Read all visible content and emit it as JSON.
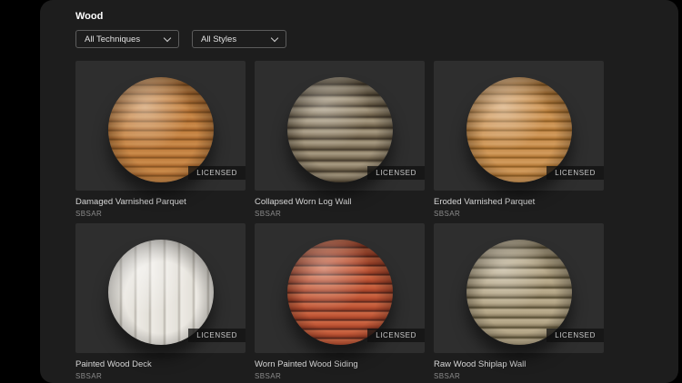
{
  "header": {
    "title": "Wood"
  },
  "filters": {
    "techniques": {
      "label": "All Techniques"
    },
    "styles": {
      "label": "All Styles"
    }
  },
  "badge_label": "LICENSED",
  "cards": [
    {
      "name": "Damaged Varnished Parquet",
      "format": "SBSAR",
      "base_color": "#b5763a"
    },
    {
      "name": "Collapsed Worn Log Wall",
      "format": "SBSAR",
      "base_color": "#8a7a62"
    },
    {
      "name": "Eroded Varnished Parquet",
      "format": "SBSAR",
      "base_color": "#c08a4e"
    },
    {
      "name": "Painted Wood Deck",
      "format": "SBSAR",
      "base_color": "#e9e6df"
    },
    {
      "name": "Worn Painted Wood Siding",
      "format": "SBSAR",
      "base_color": "#bf5a3c"
    },
    {
      "name": "Raw Wood Shiplap Wall",
      "format": "SBSAR",
      "base_color": "#b1a383"
    }
  ],
  "colors": {
    "panel_bg": "#1d1d1d",
    "tile_bg": "#2e2e2e"
  }
}
